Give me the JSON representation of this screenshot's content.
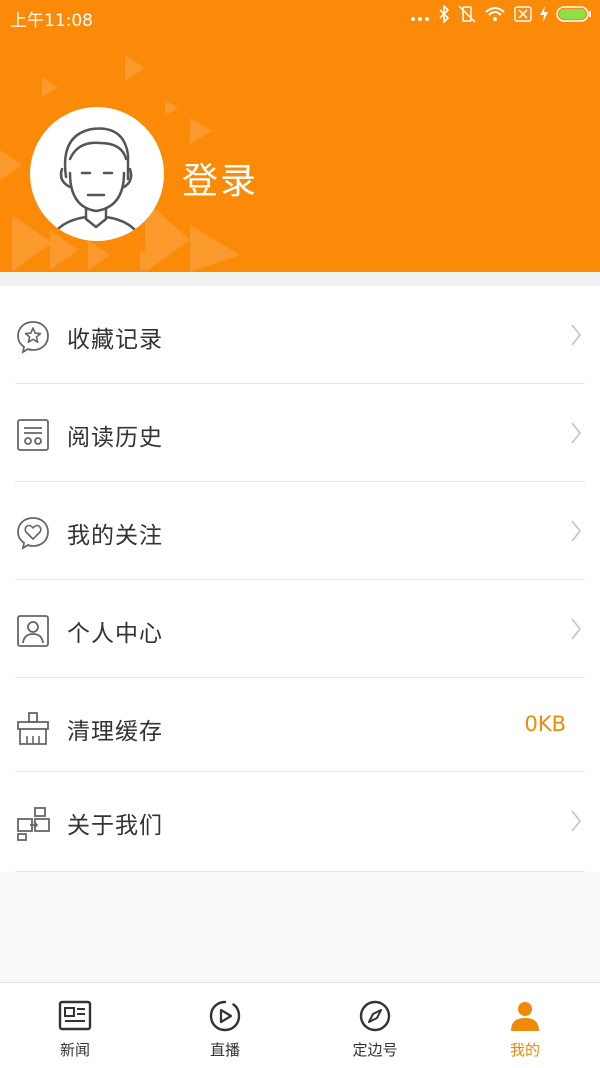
{
  "status_bar": {
    "time": "上午11:08"
  },
  "profile": {
    "login_label": "登录"
  },
  "menu": {
    "items": [
      {
        "label": "收藏记录",
        "icon": "star-chat-icon"
      },
      {
        "label": "阅读历史",
        "icon": "history-icon"
      },
      {
        "label": "我的关注",
        "icon": "heart-chat-icon"
      },
      {
        "label": "个人中心",
        "icon": "person-card-icon"
      },
      {
        "label": "清理缓存",
        "icon": "broom-icon",
        "value": "0KB"
      },
      {
        "label": "关于我们",
        "icon": "about-icon"
      }
    ]
  },
  "tabbar": {
    "items": [
      {
        "label": "新闻",
        "icon": "news-icon"
      },
      {
        "label": "直播",
        "icon": "play-icon"
      },
      {
        "label": "定边号",
        "icon": "compass-icon"
      },
      {
        "label": "我的",
        "icon": "person-icon"
      }
    ],
    "active": "我的"
  },
  "colors": {
    "accent": "#fb8a09",
    "accent_text": "#f08a0a",
    "divider": "#e6e6e6"
  }
}
